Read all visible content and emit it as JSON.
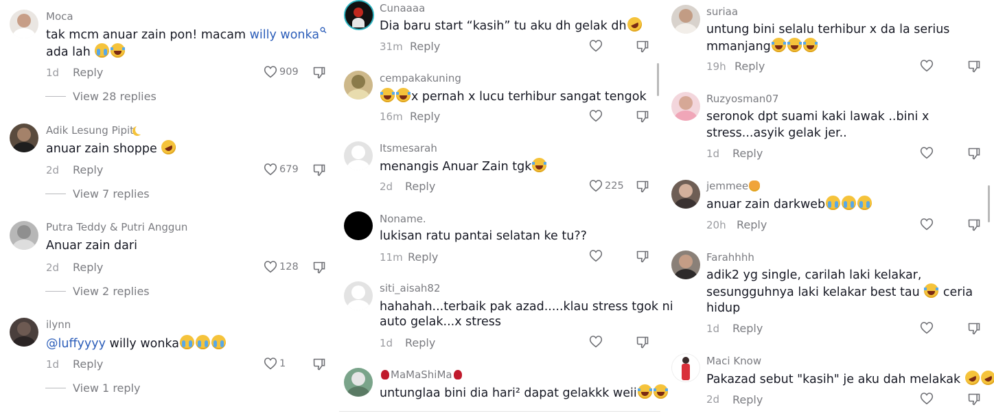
{
  "labels": {
    "reply": "Reply"
  },
  "columns": [
    {
      "comments": [
        {
          "username": "Moca",
          "text_parts": [
            "tak mcm anuar zain pon! macam ",
            "willy wonka"
          ],
          "text_line2": "ada lah",
          "time": "1d",
          "likes": "909",
          "view_replies": "View 28 replies"
        },
        {
          "username": "Adik Lesung Pipit",
          "text": "anuar zain shoppe",
          "time": "2d",
          "likes": "679",
          "view_replies": "View 7 replies"
        },
        {
          "username": "Putra Teddy & Putri Anggun",
          "text": "Anuar zain dari",
          "time": "2d",
          "likes": "128",
          "view_replies": "View 2 replies"
        },
        {
          "username": "ilynn",
          "mention": "@luffyyyy",
          "text": " willy wonka",
          "time": "1d",
          "likes": "1",
          "view_replies": "View 1 reply"
        }
      ]
    },
    {
      "comments": [
        {
          "username": "Cunaaaa",
          "text": "Dia baru start “kasih” tu aku dh gelak dh",
          "time": "31m"
        },
        {
          "username": "cempakakuning",
          "text": "x pernah x lucu terhibur sangat tengok",
          "time": "16m"
        },
        {
          "username": "Itsmesarah",
          "text": "menangis Anuar Zain tgk",
          "time": "2d",
          "likes": "225"
        },
        {
          "username": "Noname.",
          "text": "lukisan ratu pantai selatan ke tu??",
          "time": "11m"
        },
        {
          "username": "siti_aisah82",
          "text": "hahahah...terbaik pak azad.....klau stress tgok ni",
          "text_line2": "auto gelak...x stress",
          "time": "1d"
        },
        {
          "username": "MaMaShiMa",
          "text": "untunglaa bini dia hari² dapat gelakkk weii"
        }
      ]
    },
    {
      "comments": [
        {
          "username": "suriaa",
          "text": "untung bini selalu terhibur x da la serius",
          "text_line2": "mmanjang",
          "time": "19h"
        },
        {
          "username": "Ruzyosman07",
          "text": "seronok dpt suami kaki lawak ..bini x",
          "text_line2": "stress...asyik gelak jer..",
          "time": "1d"
        },
        {
          "username": "jemmee",
          "text": "anuar zain darkweb",
          "time": "20h"
        },
        {
          "username": "Farahhhh",
          "text": "adik2 yg single, carilah laki kelakar,",
          "text_line2": "sesungguhnya laki kelakar best tau",
          "text_line2_end": " ceria",
          "text_line3": "hidup",
          "time": "1d"
        },
        {
          "username": "Maci Know",
          "text": "Pakazad sebut \"kasih\" je aku dah melakak",
          "time": "2d"
        }
      ]
    }
  ]
}
